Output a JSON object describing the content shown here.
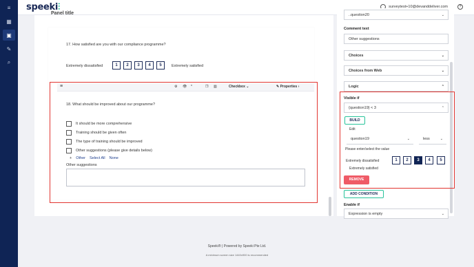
{
  "app": {
    "logo": "speeki",
    "logo_mark": "⫶"
  },
  "sidebar": {
    "items": [
      {
        "icon": "menu-icon",
        "glyph": "≡"
      },
      {
        "icon": "dashboard-icon",
        "glyph": "▦"
      },
      {
        "icon": "survey-icon",
        "glyph": "▣"
      },
      {
        "icon": "edit-icon",
        "glyph": "✎"
      },
      {
        "icon": "search-icon",
        "glyph": "⌕"
      }
    ]
  },
  "header": {
    "user_email": "surveytest+10@devanddeliver.com",
    "help": "?"
  },
  "survey": {
    "panel_title": "Panel title",
    "q17": {
      "text": "17.   How satisfied are you with our compliance programme?",
      "min_label": "Extremely dissatisfied",
      "max_label": "Extremely satisfied",
      "options": [
        "1",
        "2",
        "3",
        "4",
        "5"
      ]
    },
    "toolbar": {
      "type_label": "Checkbox",
      "properties_label": "Properties"
    },
    "q18": {
      "text": "18.   What should be improved about our programme?",
      "choices": [
        "It should be more comprehensive",
        "Training should be given often",
        "The type of training should be improved",
        "Other suggestions (please give details below)"
      ],
      "add_icon": "+",
      "links": [
        "Other",
        "Select All",
        "None"
      ],
      "comment_label": "Other suggestions"
    }
  },
  "properties": {
    "top_field": "..question20",
    "comment_text_label": "Comment text",
    "comment_text_value": "Other suggestions",
    "sections": {
      "choices": "Choices",
      "choices_web": "Choices from Web",
      "logic": "Logic"
    },
    "visible_if_label": "Visible if",
    "visible_if_value": "{question19} < 3",
    "build_label": "BUILD",
    "edit_label": "Edit",
    "edit_question": "question19",
    "edit_operator": "less",
    "enter_value_label": "Please enter/select the value",
    "rating_min": "Extremely dissatisfied",
    "rating_max": "Extremely satisfied",
    "rating_options": [
      "1",
      "2",
      "3",
      "4",
      "5"
    ],
    "rating_selected": "3",
    "remove_label": "REMOVE",
    "add_condition_label": "ADD CONDITION",
    "enable_if_label": "Enable if",
    "enable_if_value": "Expression is empty"
  },
  "footer": {
    "line1": "Speeki® | Powered by Speeki Pte Ltd.",
    "line2": "A minimum screen size 1440x900 is recommended"
  },
  "colors": {
    "navy": "#0f2455",
    "accent_green": "#27c39a",
    "remove_red": "#ef5b67",
    "highlight_red": "#e2342f"
  }
}
